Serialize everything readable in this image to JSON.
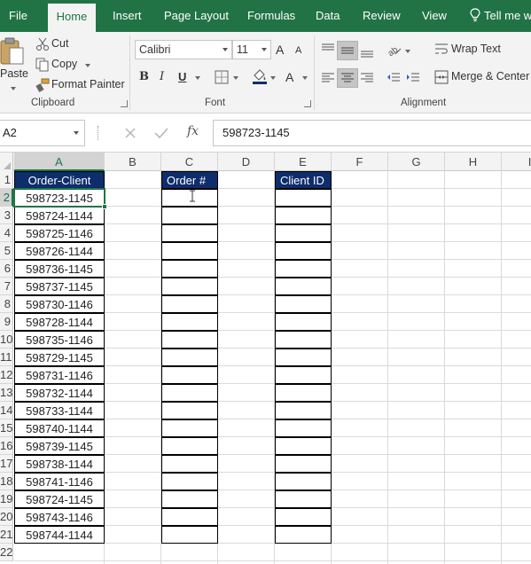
{
  "tabs": [
    {
      "label": "File",
      "active": false
    },
    {
      "label": "Home",
      "active": true
    },
    {
      "label": "Insert",
      "active": false
    },
    {
      "label": "Page Layout",
      "active": false
    },
    {
      "label": "Formulas",
      "active": false
    },
    {
      "label": "Data",
      "active": false
    },
    {
      "label": "Review",
      "active": false
    },
    {
      "label": "View",
      "active": false
    }
  ],
  "tell_me": "Tell me w",
  "clipboard": {
    "paste": "Paste",
    "cut": "Cut",
    "copy": "Copy",
    "format_painter": "Format Painter",
    "label": "Clipboard"
  },
  "font": {
    "name": "Calibri",
    "size": "11",
    "grow": "A",
    "shrink": "A",
    "bold": "B",
    "italic": "I",
    "underline": "U",
    "font_color": "A",
    "label": "Font"
  },
  "alignment": {
    "wrap_text": "Wrap Text",
    "merge_center": "Merge & Center",
    "label": "Alignment"
  },
  "name_box": "A2",
  "formula_bar": {
    "fx": "fx",
    "value": "598723-1145"
  },
  "columns": [
    "A",
    "B",
    "C",
    "D",
    "E",
    "F",
    "G",
    "H",
    "I"
  ],
  "rows": [
    "1",
    "2",
    "3",
    "4",
    "5",
    "6",
    "7",
    "8",
    "9",
    "10",
    "11",
    "12",
    "13",
    "14",
    "15",
    "16",
    "17",
    "18",
    "19",
    "20",
    "21",
    "22"
  ],
  "headers": {
    "a1": "Order-Client",
    "c1": "Order #",
    "e1": "Client ID"
  },
  "order_client_values": [
    "598723-1145",
    "598724-1144",
    "598725-1146",
    "598726-1144",
    "598736-1145",
    "598737-1145",
    "598730-1146",
    "598728-1144",
    "598735-1146",
    "598729-1145",
    "598731-1146",
    "598732-1144",
    "598733-1144",
    "598740-1144",
    "598739-1145",
    "598738-1144",
    "598741-1146",
    "598724-1145",
    "598743-1146",
    "598744-1144"
  ],
  "colors": {
    "excel_green": "#217346",
    "header_fill": "#0e2d6b",
    "header_text": "#ffffff"
  }
}
